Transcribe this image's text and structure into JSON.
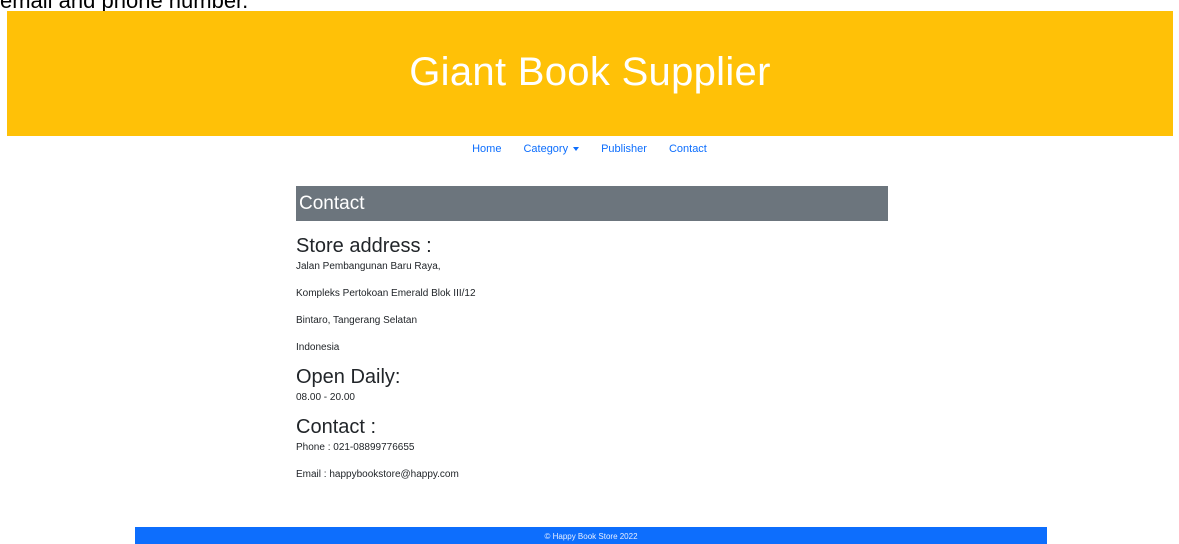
{
  "caption": "email and phone number.",
  "banner": {
    "title": "Giant Book Supplier"
  },
  "nav": {
    "items": [
      {
        "label": "Home"
      },
      {
        "label": "Category"
      },
      {
        "label": "Publisher"
      },
      {
        "label": "Contact"
      }
    ]
  },
  "section": {
    "title": "Contact"
  },
  "address": {
    "heading": "Store address :",
    "lines": [
      "Jalan Pembangunan Baru Raya,",
      "Kompleks Pertokoan Emerald Blok III/12",
      "Bintaro, Tangerang Selatan",
      "Indonesia"
    ]
  },
  "hours": {
    "heading": "Open Daily:",
    "value": "08.00 - 20.00"
  },
  "contact": {
    "heading": "Contact :",
    "phone": "Phone : 021-08899776655",
    "email": "Email : happybookstore@happy.com"
  },
  "footer": {
    "text": "© Happy Book Store 2022"
  },
  "colors": {
    "banner": "#ffc107",
    "nav_link": "#0d6efd",
    "section_bar": "#6c757d",
    "footer": "#0d6efd"
  }
}
